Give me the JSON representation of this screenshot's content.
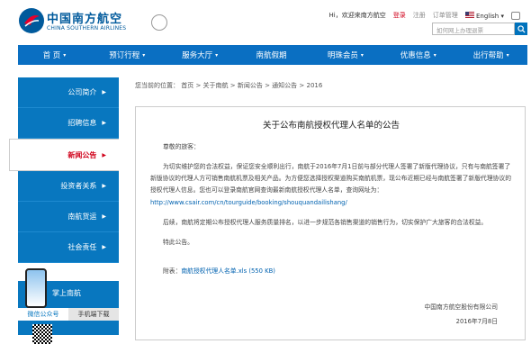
{
  "header": {
    "logo_cn": "中国南方航空",
    "logo_en": "CHINA SOUTHERN AIRLINES",
    "greeting": "Hi，欢迎来南方航空",
    "login": "登录",
    "register": "注册",
    "order_mgmt": "订单管理",
    "language": "English",
    "search_placeholder": "如何网上办理退票"
  },
  "nav": {
    "items": [
      {
        "label": "首 页",
        "caret": "▾"
      },
      {
        "label": "预订行程",
        "caret": "▾"
      },
      {
        "label": "服务大厅",
        "caret": "▾"
      },
      {
        "label": "南航假期",
        "caret": ""
      },
      {
        "label": "明珠会员",
        "caret": "▾"
      },
      {
        "label": "优惠信息",
        "caret": "▾"
      },
      {
        "label": "出行帮助",
        "caret": "▾"
      }
    ]
  },
  "sidebar": {
    "items": [
      {
        "label": "公司简介"
      },
      {
        "label": "招聘信息"
      },
      {
        "label": "新闻公告"
      },
      {
        "label": "投资者关系"
      },
      {
        "label": "南航货运"
      },
      {
        "label": "社会责任"
      }
    ],
    "app_title": "掌上南航",
    "app_tab1": "微信公众号",
    "app_tab2": "手机端下载"
  },
  "breadcrumb": "您当前的位置： 首页 > 关于南航 > 新闻公告 > 通知公告 > 2016",
  "article": {
    "title": "关于公布南航授权代理人名单的公告",
    "salutation": "尊敬的旅客：",
    "p1": "为切实维护您的合法权益，保证您安全顺利出行，南航于2016年7月1日前与部分代理人签署了新版代理协议，只有与南航签署了新版协议的代理人方可销售南航机票及相关产品。为方便您选择授权渠道购买南航机票，现公布近期已经与南航签署了新版代理协议的授权代理人信息。您也可以登录南航官网查询最新南航授权代理人名单，查询网址为：",
    "url": "http://www.csair.com/cn/tourguide/booking/shouquandailishang/",
    "p2": "后续，南航将定期公布授权代理人服务质量排名，以进一步规范各销售渠道的销售行为，切实保护广大旅客的合法权益。",
    "p3": "特此公告。",
    "attach_label": "附表：",
    "attach_link": "南航授权代理人名单.xls (550 KB)",
    "sign": "中国南方航空股份有限公司",
    "date": "2016年7月8日"
  },
  "colors": {
    "nav_blue": "#0a6fc2",
    "side_blue": "#0877bf",
    "active_red": "#d0021b"
  },
  "icons": [
    "logo-icon",
    "globe-icon",
    "flag-icon",
    "share-icon",
    "search-icon",
    "chevron-right-icon",
    "phone-icon",
    "qr-code-icon"
  ]
}
